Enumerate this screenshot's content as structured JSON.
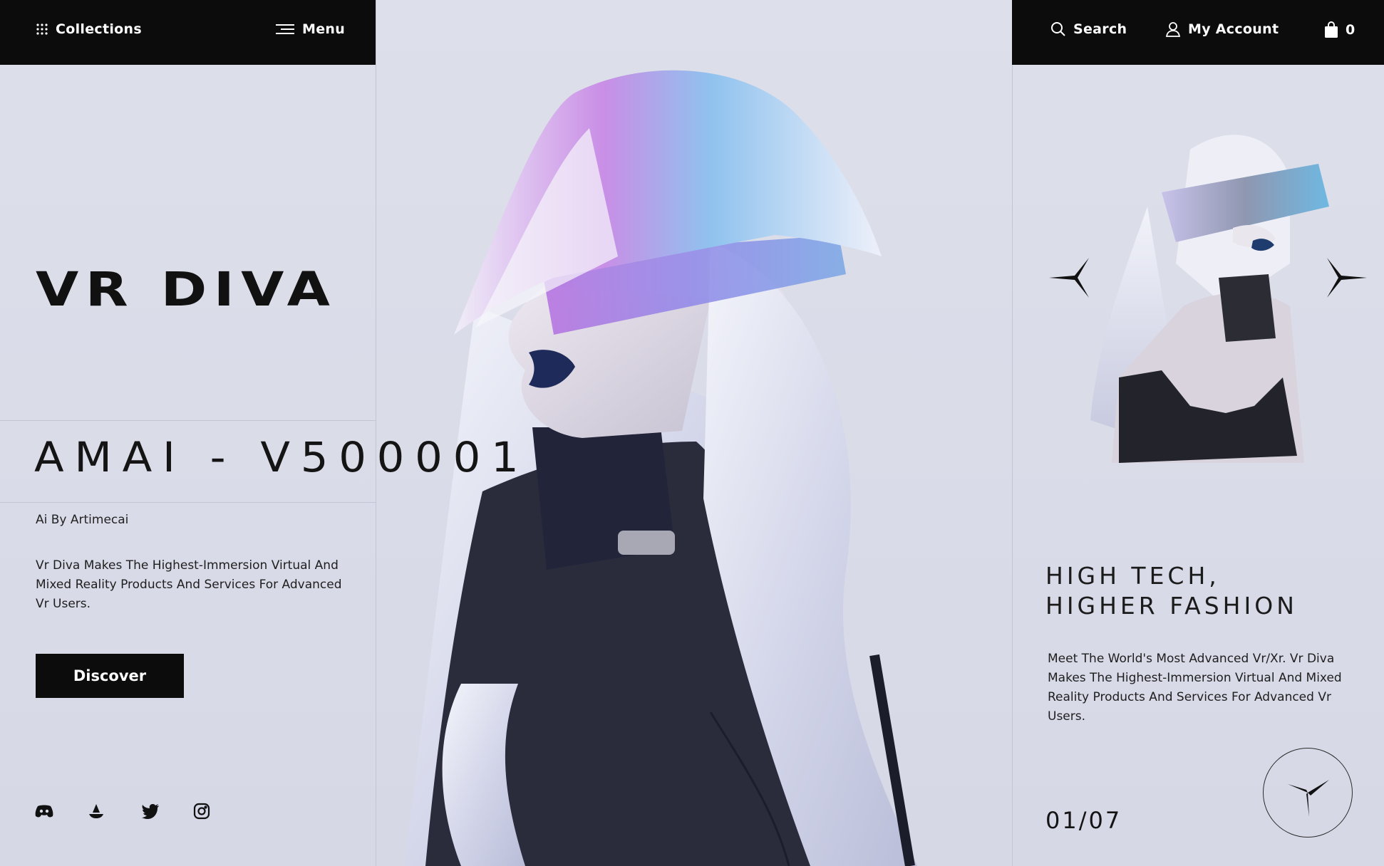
{
  "nav": {
    "collections_label": "Collections",
    "menu_label": "Menu",
    "search_label": "Search",
    "account_label": "My Account",
    "cart_count": "0"
  },
  "left": {
    "brand": "VR DIVA",
    "model": "AMAI - V500001",
    "byline": "Ai By Artimecai",
    "description": "Vr Diva Makes The Highest-Immersion Virtual And Mixed Reality Products And Services For Advanced Vr Users.",
    "cta_label": "Discover",
    "socials": [
      "discord-icon",
      "opensea-icon",
      "twitter-icon",
      "instagram-icon"
    ]
  },
  "right": {
    "tagline_line1": "HIGH TECH,",
    "tagline_line2": "HIGHER FASHION",
    "description": "Meet The World's Most Advanced Vr/Xr. Vr Diva Makes The Highest-Immersion Virtual And Mixed Reality Products And Services For Advanced Vr Users.",
    "counter": "01/07"
  },
  "colors": {
    "background": "#dcdee9",
    "bar": "#0c0c0d",
    "text": "#111111"
  }
}
